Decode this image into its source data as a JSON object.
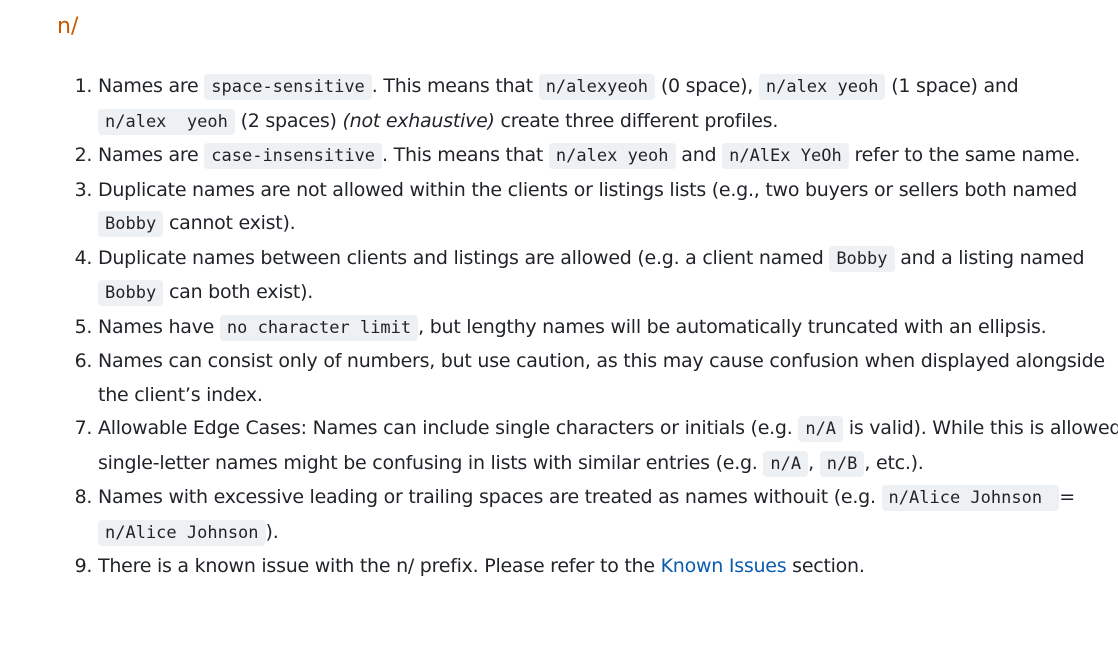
{
  "heading": "n/",
  "items": [
    {
      "t1": "Names are ",
      "c1": "space-sensitive",
      "t2": ". This means that ",
      "c2": "n/alexyeoh",
      "t3": " (0 space), ",
      "c3": "n/alex yeoh",
      "t4": " (1 space) and ",
      "c4": "n/alex  yeoh",
      "t5": " (2 spaces) ",
      "em": "(not exhaustive)",
      "t6": " create three different profiles."
    },
    {
      "t1": "Names are ",
      "c1": "case-insensitive",
      "t2": ". This means that ",
      "c2": "n/alex yeoh",
      "t3": " and ",
      "c3": "n/AlEx YeOh",
      "t4": " refer to the same name."
    },
    {
      "t1": "Duplicate names are not allowed within the clients or listings lists (e.g., two buyers or sellers both named ",
      "c1": "Bobby",
      "t2": " cannot exist)."
    },
    {
      "t1": "Duplicate names between clients and listings are allowed (e.g. a client named ",
      "c1": "Bobby",
      "t2": " and a listing named ",
      "c2": "Bobby",
      "t3": " can both exist)."
    },
    {
      "t1": "Names have ",
      "c1": "no character limit",
      "t2": ", but lengthy names will be automatically truncated with an ellipsis."
    },
    {
      "t1": "Names can consist only of numbers, but use caution, as this may cause confusion when displayed alongside the client’s index."
    },
    {
      "t1": "Allowable Edge Cases: Names can include single characters or initials (e.g. ",
      "c1": "n/A",
      "t2": " is valid). While this is allowed, single-letter names might be confusing in lists with similar entries (e.g. ",
      "c2": "n/A",
      "t3": ", ",
      "c3": "n/B",
      "t4": ", etc.)."
    },
    {
      "t1": "Names with excessive leading or trailing spaces are treated as names withouit (e.g. ",
      "c1": "n/Alice          Johnson   ",
      "t2": " = ",
      "c2": "n/Alice Johnson",
      "t3": ")."
    },
    {
      "t1": "There is a known issue with the n/ prefix. Please refer to the ",
      "link": "Known Issues",
      "t2": " section."
    }
  ]
}
